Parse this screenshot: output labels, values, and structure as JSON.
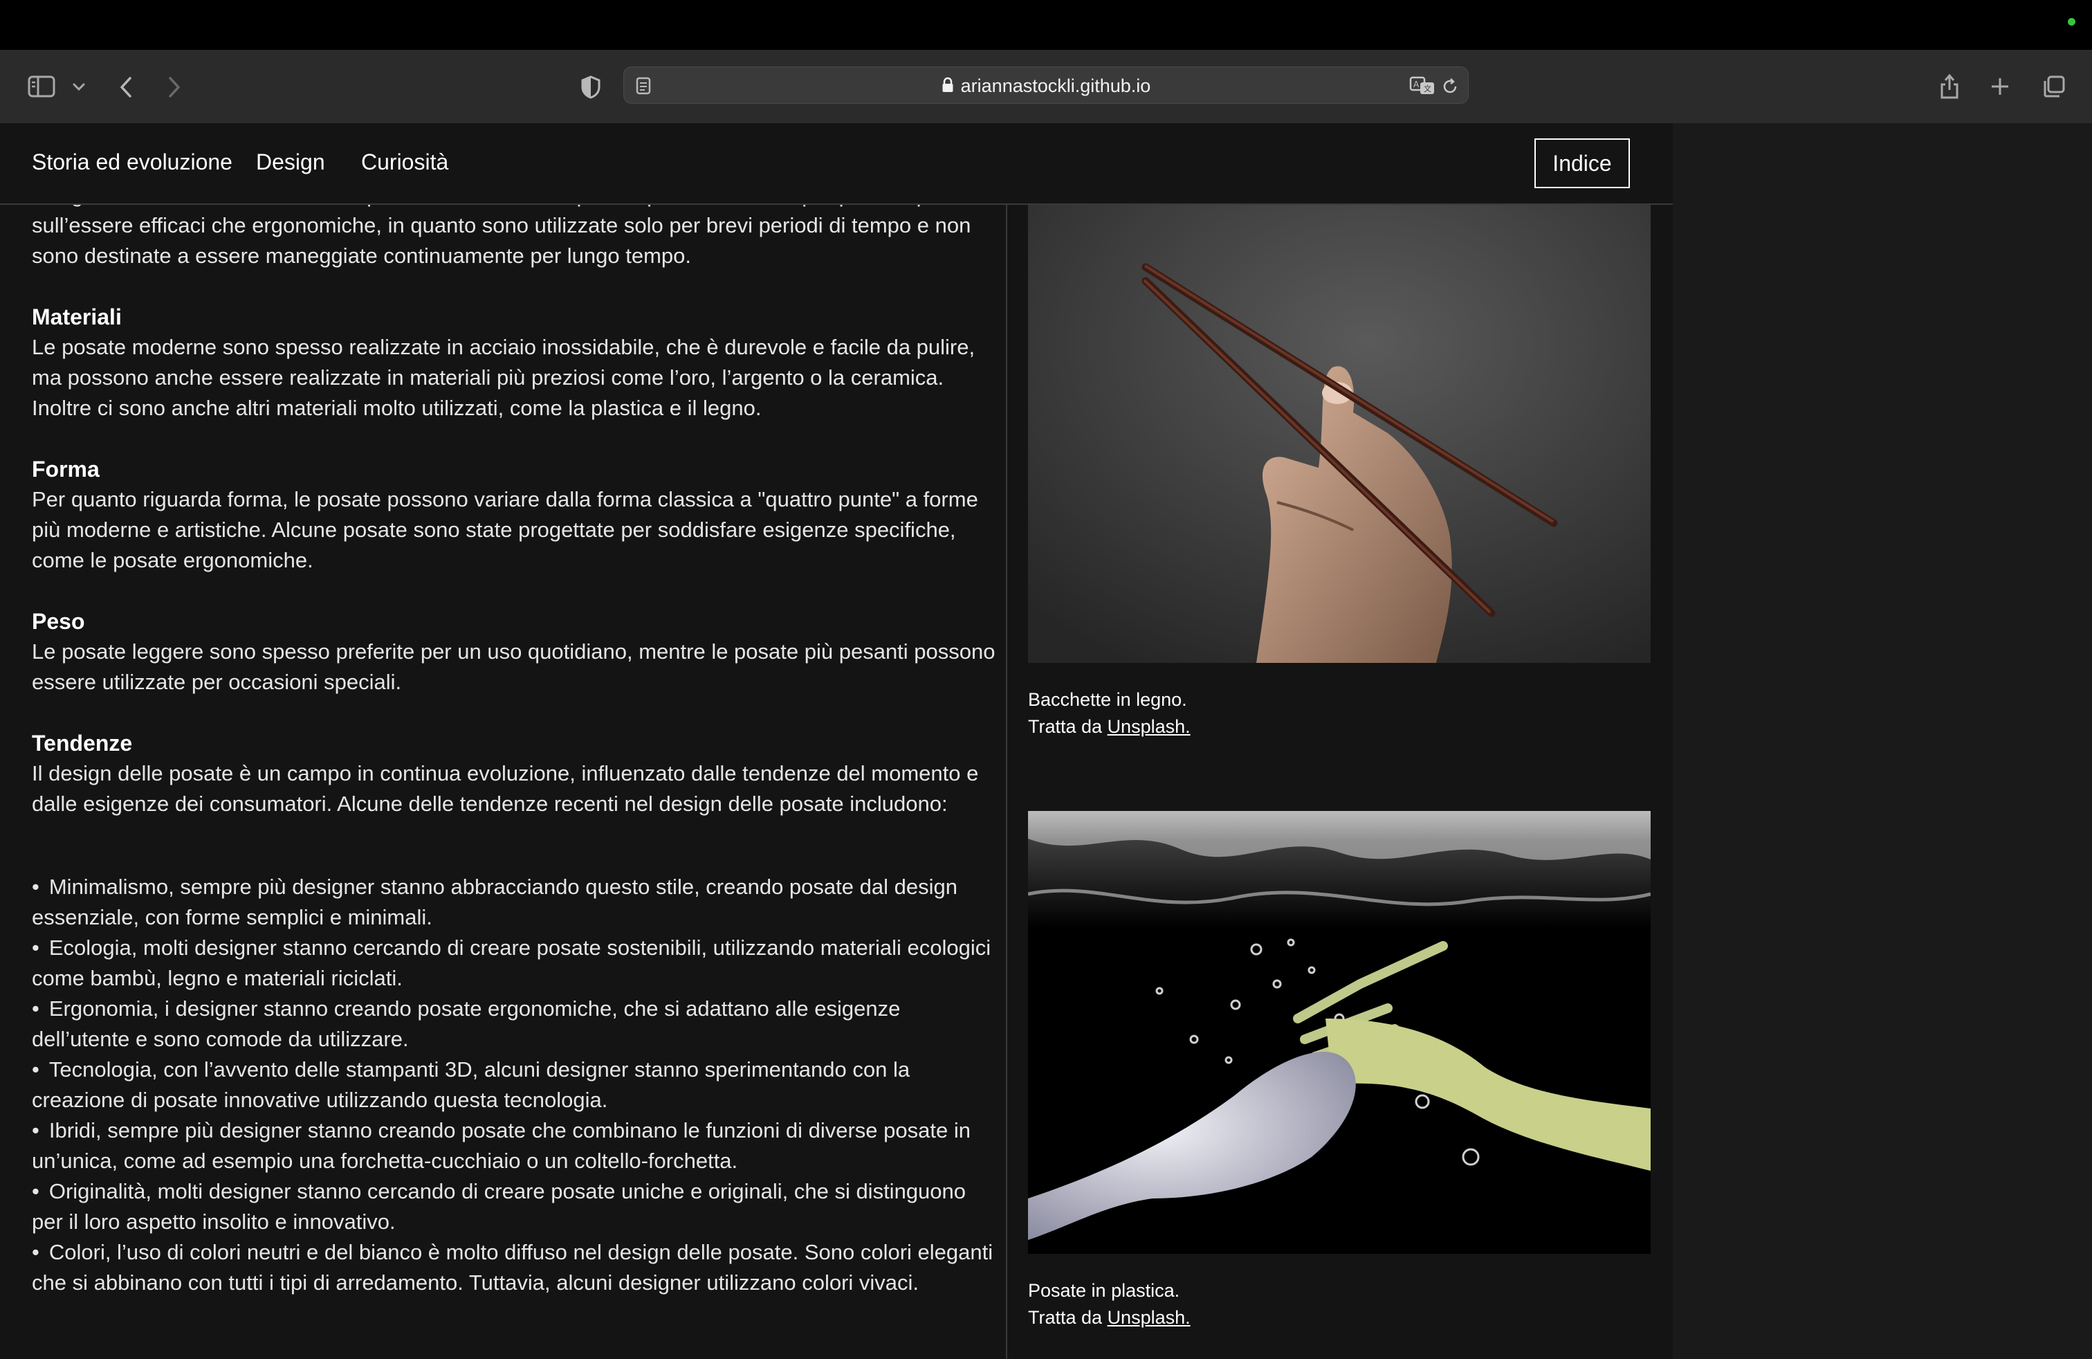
{
  "browser": {
    "url": "ariannastockli.github.io",
    "icons": [
      "sidebar-icon",
      "chevron-down-icon",
      "back-icon",
      "forward-icon",
      "shield-icon",
      "reader-icon",
      "lock-icon",
      "translate-icon",
      "reload-icon",
      "share-icon",
      "plus-icon",
      "tabs-icon"
    ]
  },
  "header": {
    "nav": [
      "Storia ed evoluzione",
      "Design",
      "Curiosità"
    ],
    "index_label": "Indice"
  },
  "intro": "design inoltre influisce molto sull’esperienza culinaria. Le posate però hanno sempre puntato più sull’essere efficaci che ergonomiche, in quanto sono utilizzate solo per brevi periodi di tempo e non sono destinate a essere maneggiate continuamente per lungo tempo.",
  "sections": [
    {
      "title": "Materiali",
      "text": "Le posate moderne sono spesso realizzate in acciaio inossidabile, che è durevole e facile da pulire, ma possono anche essere realizzate in materiali più preziosi come l’oro, l’argento o la ceramica. Inoltre ci sono anche altri materiali molto utilizzati, come la plastica e il legno."
    },
    {
      "title": "Forma",
      "text": "Per quanto riguarda forma, le posate possono variare dalla forma classica a \"quattro punte\" a forme più moderne e artistiche. Alcune posate sono state progettate per soddisfare esigenze specifiche, come le posate ergonomiche."
    },
    {
      "title": "Peso",
      "text": "Le posate leggere sono spesso preferite per un uso quotidiano, mentre le posate più pesanti possono essere utilizzate per occasioni speciali."
    },
    {
      "title": "Tendenze",
      "text": "Il design delle posate è un campo in continua evoluzione, influenzato dalle tendenze del momento e dalle esigenze dei consumatori. Alcune delle tendenze recenti nel design delle posate includono:"
    }
  ],
  "trends": [
    "Minimalismo, sempre più designer stanno abbracciando questo stile, creando posate dal design essenziale, con forme semplici e minimali.",
    "Ecologia, molti designer stanno cercando di creare posate sostenibili, utilizzando materiali ecologici come bambù, legno e materiali riciclati.",
    "Ergonomia, i designer stanno creando posate ergonomiche, che si adattano alle esigenze dell’utente e sono comode da utilizzare.",
    "Tecnologia, con l’avvento delle stampanti 3D, alcuni designer stanno sperimentando con la creazione di posate innovative utilizzando questa tecnologia.",
    "Ibridi, sempre più designer stanno creando posate che combinano le funzioni di diverse posate in un’unica, come ad esempio una forchetta-cucchiaio o un coltello-forchetta.",
    "Originalità, molti designer stanno cercando di creare posate uniche e originali, che si distinguono per il loro aspetto insolito e innovativo.",
    "Colori, l’uso di colori neutri e del bianco è molto diffuso nel design delle posate. Sono colori eleganti che si abbinano con tutti i tipi di arredamento. Tuttavia, alcuni designer utilizzano colori vivaci."
  ],
  "figures": [
    {
      "caption": "Bacchette in legno.",
      "credit_prefix": "Tratta da ",
      "credit_link": "Unsplash."
    },
    {
      "caption": "Posate in plastica.",
      "credit_prefix": "Tratta da ",
      "credit_link": "Unsplash."
    }
  ],
  "colors": {
    "page_bg": "#141414",
    "text": "#e6e6e6",
    "toolbar": "#2b2b2c",
    "status_dot": "#39c440"
  }
}
